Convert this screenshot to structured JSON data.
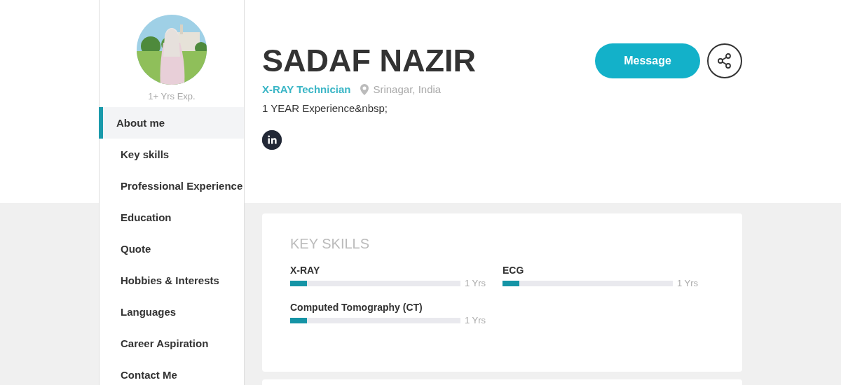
{
  "sidebar": {
    "experience": "1+ Yrs Exp.",
    "items": [
      {
        "label": "About me",
        "selected": true
      },
      {
        "label": "Key skills",
        "selected": false
      },
      {
        "label": "Professional Experience",
        "selected": false
      },
      {
        "label": "Education",
        "selected": false
      },
      {
        "label": "Quote",
        "selected": false
      },
      {
        "label": "Hobbies & Interests",
        "selected": false
      },
      {
        "label": "Languages",
        "selected": false
      },
      {
        "label": "Career Aspiration",
        "selected": false
      },
      {
        "label": "Contact Me",
        "selected": false
      }
    ]
  },
  "profile": {
    "name": "SADAF NAZIR",
    "role": "X-RAY Technician",
    "location": "Srinagar, India",
    "summary": "1 YEAR Experience&nbsp;",
    "message_button": "Message"
  },
  "key_skills": {
    "title": "KEY SKILLS",
    "skills": [
      {
        "name": "X-RAY",
        "level": 0.1,
        "years": "1 Yrs"
      },
      {
        "name": "ECG",
        "level": 0.1,
        "years": "1 Yrs"
      },
      {
        "name": "Computed Tomography (CT)",
        "level": 0.1,
        "years": "1 Yrs"
      }
    ]
  }
}
